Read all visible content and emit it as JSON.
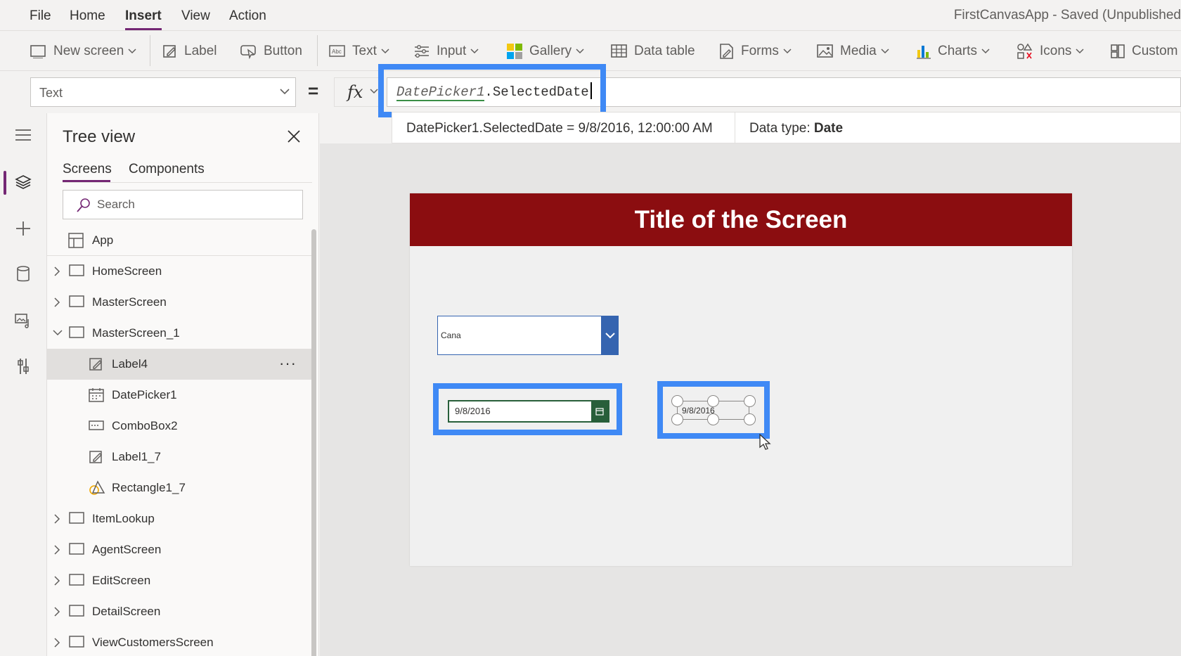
{
  "menubar": {
    "items": [
      "File",
      "Home",
      "Insert",
      "View",
      "Action"
    ],
    "active": "Insert",
    "app_status": "FirstCanvasApp - Saved (Unpublished"
  },
  "ribbon": {
    "new_screen": "New screen",
    "label": "Label",
    "button": "Button",
    "text": "Text",
    "input": "Input",
    "gallery": "Gallery",
    "data_table": "Data table",
    "forms": "Forms",
    "media": "Media",
    "charts": "Charts",
    "icons": "Icons",
    "custom": "Custom"
  },
  "formula": {
    "property": "Text",
    "equals": "=",
    "fx": "fx",
    "control": "DatePicker1",
    "member": ".SelectedDate"
  },
  "intellisense": {
    "expression": "DatePicker1.SelectedDate  =  9/8/2016, 12:00:00 AM",
    "datatype_label": "Data type:",
    "datatype_value": "Date"
  },
  "treeview": {
    "title": "Tree view",
    "tabs": [
      "Screens",
      "Components"
    ],
    "search_placeholder": "Search",
    "items": [
      {
        "label": "App",
        "kind": "app"
      },
      {
        "label": "HomeScreen",
        "kind": "screen",
        "expanded": false
      },
      {
        "label": "MasterScreen",
        "kind": "screen",
        "expanded": false
      },
      {
        "label": "MasterScreen_1",
        "kind": "screen",
        "expanded": true
      },
      {
        "label": "Label4",
        "kind": "label",
        "selected": true
      },
      {
        "label": "DatePicker1",
        "kind": "datepicker"
      },
      {
        "label": "ComboBox2",
        "kind": "combobox"
      },
      {
        "label": "Label1_7",
        "kind": "label"
      },
      {
        "label": "Rectangle1_7",
        "kind": "rectangle"
      },
      {
        "label": "ItemLookup",
        "kind": "screen",
        "expanded": false
      },
      {
        "label": "AgentScreen",
        "kind": "screen",
        "expanded": false
      },
      {
        "label": "EditScreen",
        "kind": "screen",
        "expanded": false
      },
      {
        "label": "DetailScreen",
        "kind": "screen",
        "expanded": false
      },
      {
        "label": "ViewCustomersScreen",
        "kind": "screen",
        "expanded": false
      }
    ],
    "more_label": "···"
  },
  "canvas": {
    "title": "Title of the Screen",
    "combo_value": "Cana",
    "datepicker_value": "9/8/2016",
    "label4_value": "9/8/2016"
  },
  "colors": {
    "accent": "#742774",
    "highlight": "#3f89f5",
    "title_bar": "#8b0d10",
    "datepicker": "#285f3a",
    "combo": "#3564b0"
  }
}
